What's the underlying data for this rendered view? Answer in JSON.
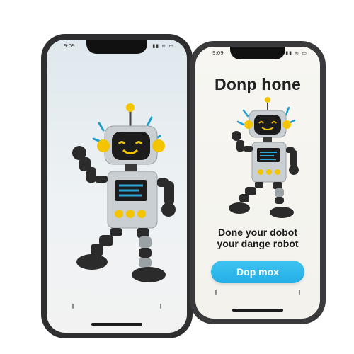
{
  "status_bar": {
    "left_time": "9:09",
    "right_time": "9:09",
    "icons": "▮▮ ≋ ▭"
  },
  "right_screen": {
    "title": "Donp hone",
    "tagline_line1": "Done your dobot",
    "tagline_line2": "your dange robot",
    "button_label": "Dop mox"
  },
  "colors": {
    "accent": "#23aee6",
    "robot_body": "#c9cfd2",
    "robot_dark": "#2b2b2b",
    "robot_yellow": "#f2c500",
    "robot_screen": "#2aa7d6"
  },
  "icons": [
    "robot-illustration",
    "home-indicator"
  ]
}
